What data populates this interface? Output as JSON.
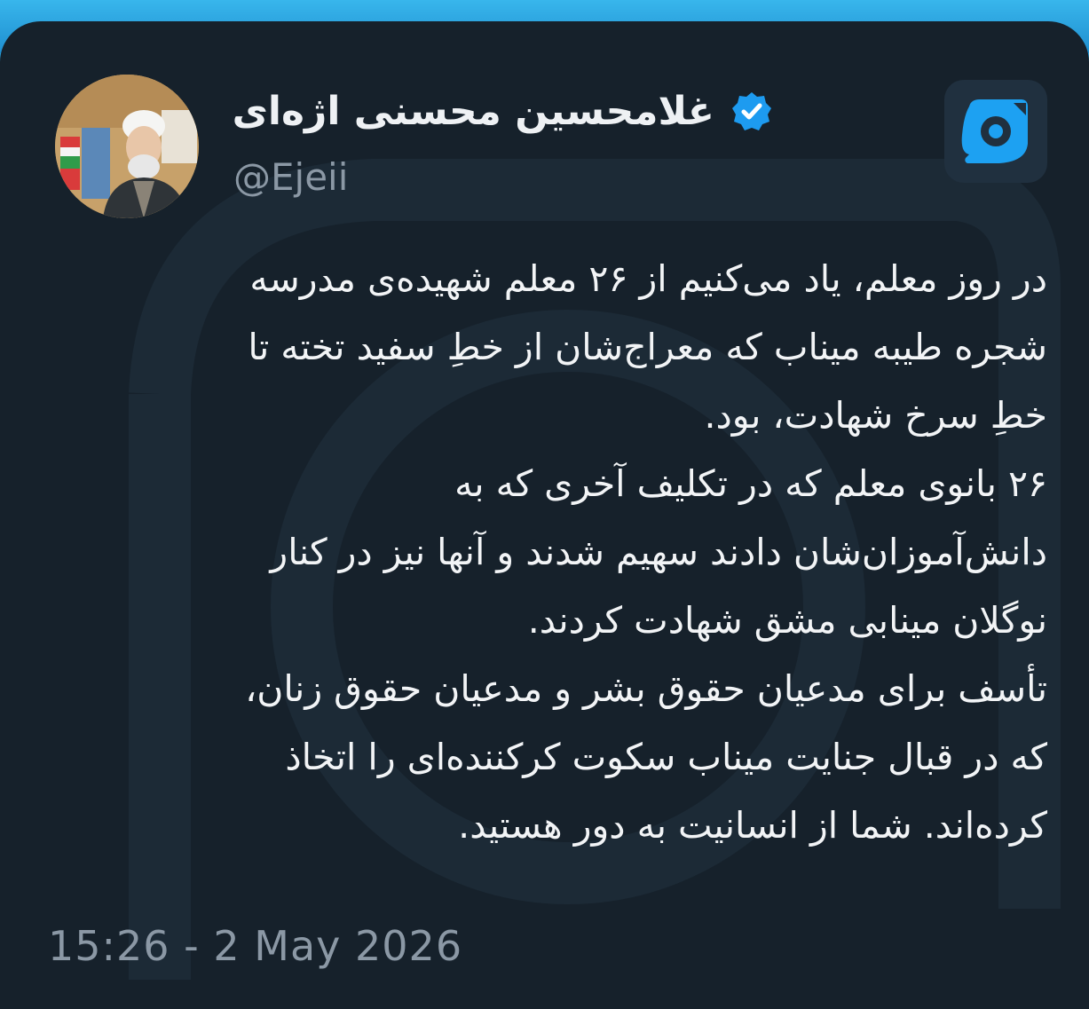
{
  "tweet": {
    "author_name": "غلامحسین محسنی اژه‌ای",
    "handle": "@Ejeii",
    "verified": true,
    "body_lines": [
      "در روز معلم، یاد می‌کنیم از ۲۶ معلم شهیده‌ی مدرسه",
      "شجره طیبه میناب که معراج‌شان از خطِ سفید تخته تا",
      "خطِ سرخ شهادت، بود.",
      "۲۶ بانوی معلم که در تکلیف آخری که به",
      "دانش‌آموزان‌شان دادند سهیم شدند و آنها نیز در کنار",
      "نوگلان مینابی مشق شهادت کردند.",
      "تأسف برای مدعیان حقوق بشر و مدعیان حقوق زنان،",
      "که در قبال جنایت میناب سکوت کرکننده‌ای را اتخاذ",
      "کرده‌اند. شما از انسانیت به دور هستید."
    ],
    "timestamp": "15:26 - 2 May 2026"
  },
  "icons": {
    "verified": "verified-badge-icon",
    "app_logo": "app-logo-icon",
    "avatar": "profile-avatar"
  },
  "colors": {
    "background": "#16212b",
    "frame": "#2aa3dd",
    "text": "#f2f4f6",
    "muted": "#8b98a5",
    "verified": "#1d9bf0",
    "logo_accent": "#1da1f2"
  }
}
